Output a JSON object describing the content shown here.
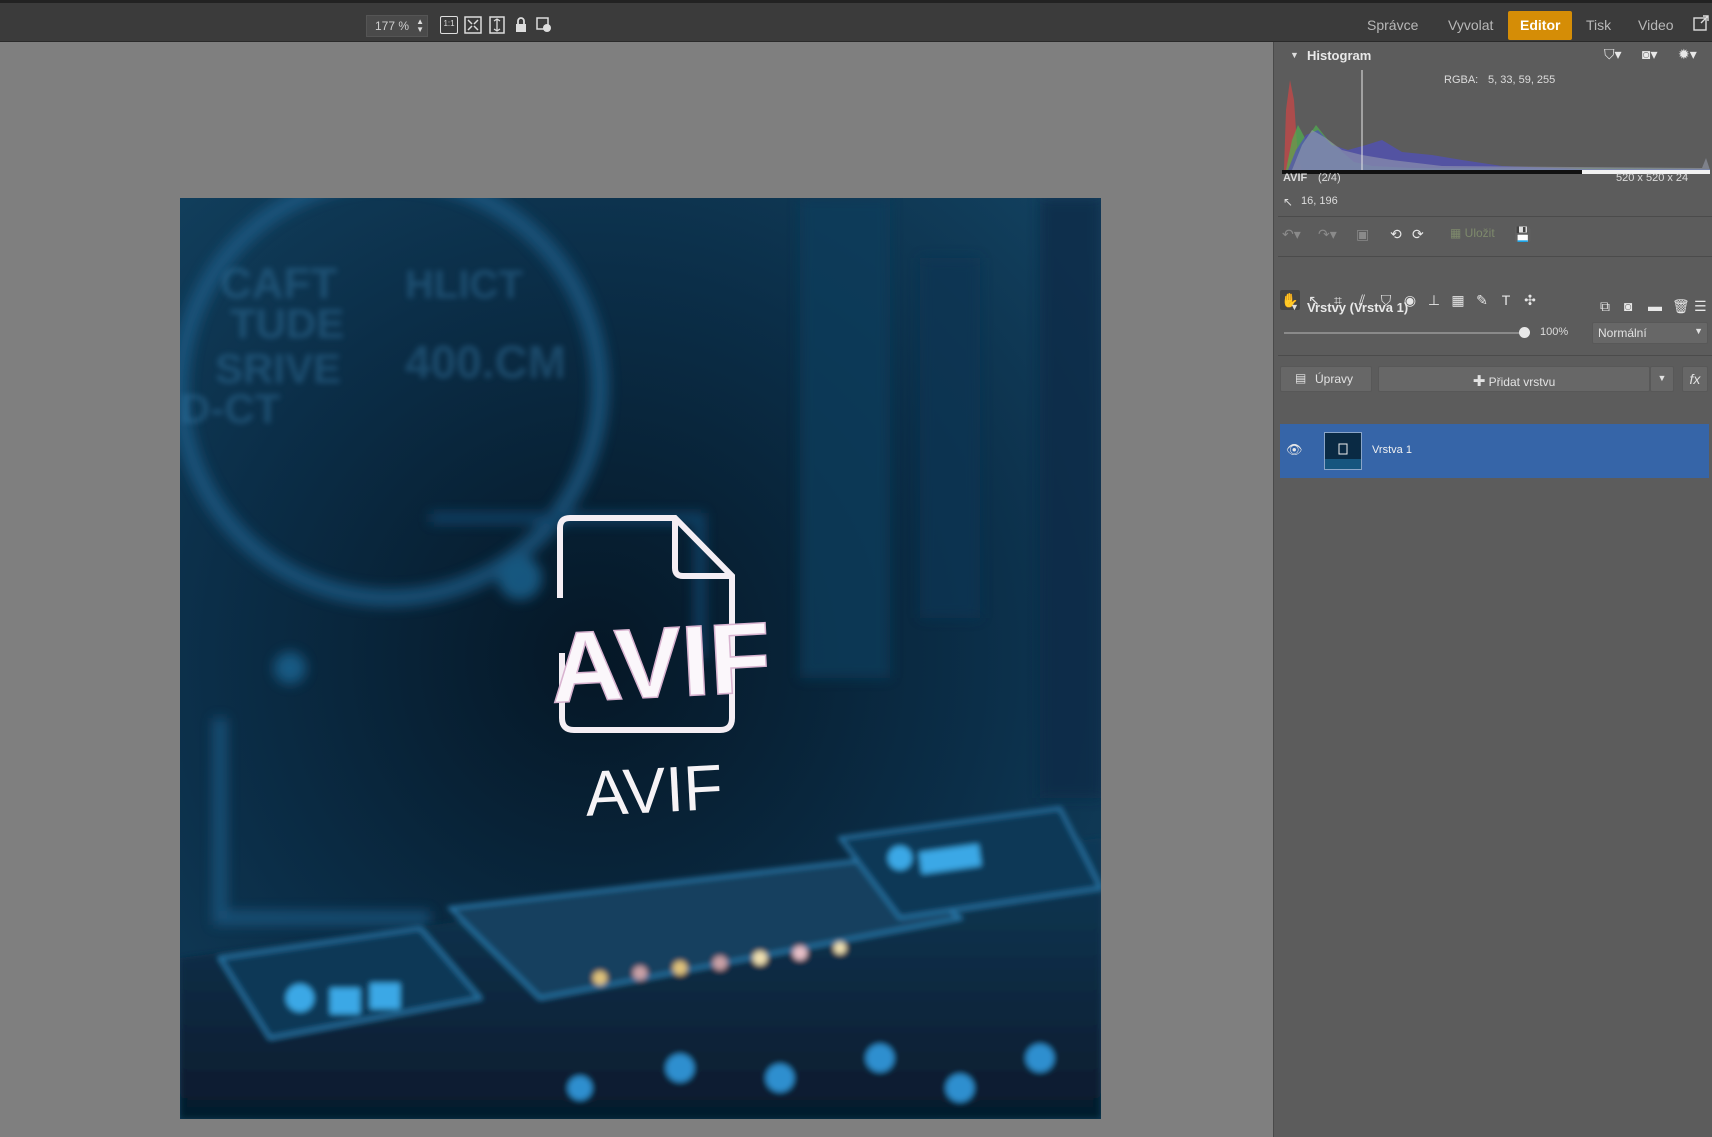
{
  "toolbar": {
    "zoom_value": "177 %",
    "icons": [
      "zoom-1to1-icon",
      "fit-screen-icon",
      "fit-height-icon",
      "lock-icon",
      "loupe-settings-icon"
    ]
  },
  "nav": {
    "items": [
      "Správce",
      "Vyvolat",
      "Editor",
      "Tisk",
      "Video"
    ],
    "active": "Editor",
    "accent_color": "#d58d06"
  },
  "histogram": {
    "title": "Histogram",
    "rgba_label": "RGBA:",
    "rgba_value": "5,  33,  59, 255",
    "format": "AVIF",
    "index": "(2/4)",
    "dimensions": "520 x 520 x 24",
    "cursor_pos": "16, 196"
  },
  "actions": {
    "save_label": "Uložit"
  },
  "layers": {
    "title": "Vrstvy (Vrstva 1)",
    "opacity": "100%",
    "blend_mode": "Normální",
    "adjust_label": "Úpravy",
    "add_layer_label": "Přidat vrstvu",
    "fx_label": "fx",
    "items": [
      {
        "name": "Vrstva 1",
        "selected": true,
        "visible": true
      }
    ]
  },
  "image": {
    "big_text": "AVIF",
    "small_text": "AVIF",
    "bg_texts": [
      "CAFT",
      "TUDE",
      "SRIVE",
      "D-CT",
      "HLICT",
      "400.CM"
    ]
  }
}
